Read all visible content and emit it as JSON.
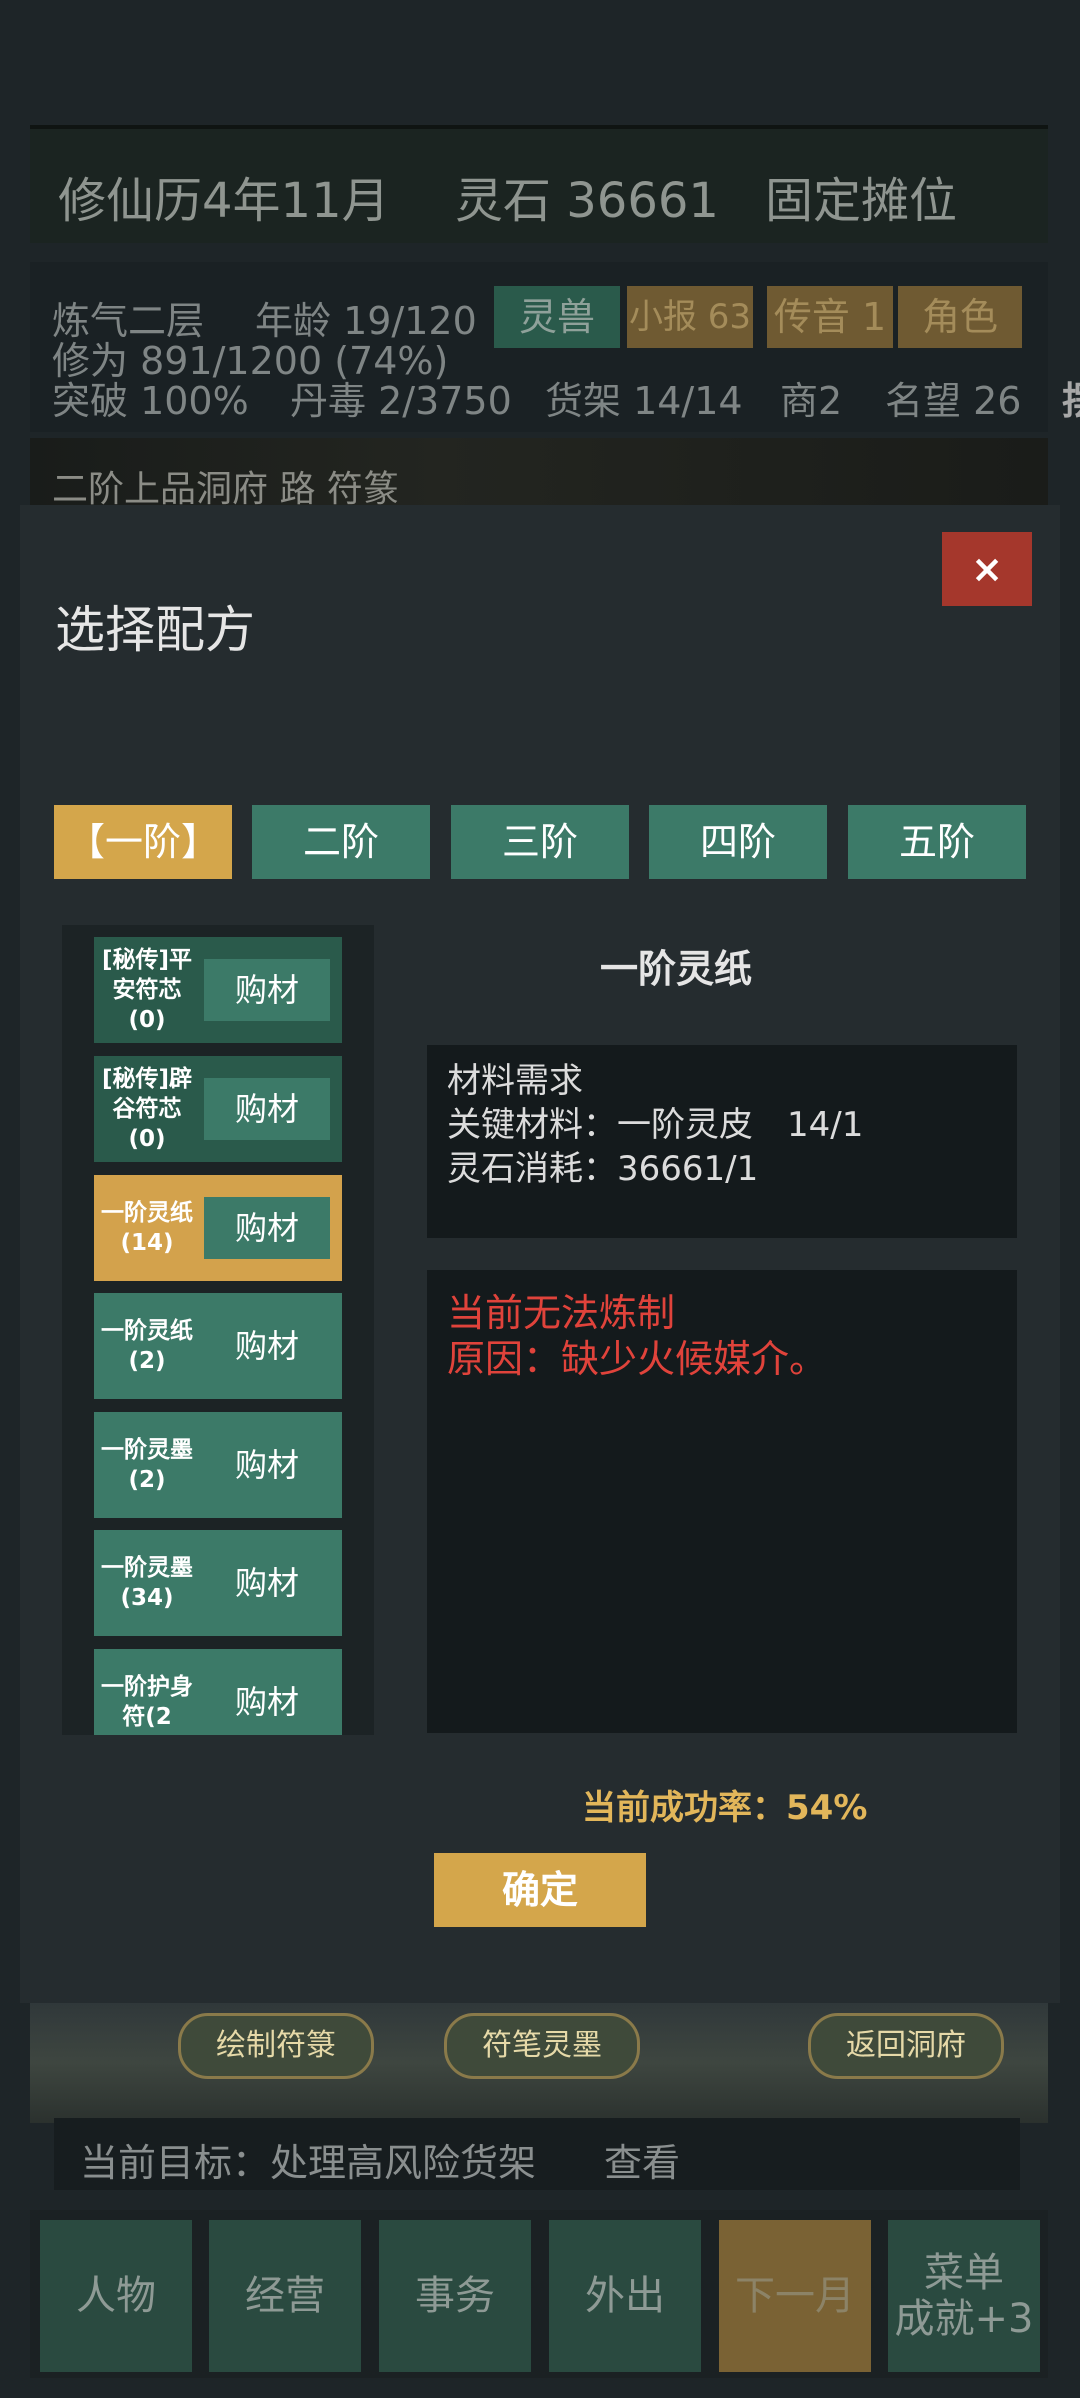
{
  "header": {
    "date": "修仙历4年11月",
    "spirit_stone": "灵石 36661",
    "stall": "固定摊位"
  },
  "stats": {
    "realm": "炼气二层",
    "age": "年龄 19/120",
    "cultivation": "修为 891/1200 (74%)",
    "breakthrough": "突破 100%",
    "poison": "丹毒 2/3750",
    "shelf": "货架 14/14",
    "merchant": "商2",
    "fame": "名望 26",
    "edge_char": "摆"
  },
  "top_buttons": {
    "beast": "灵兽",
    "news": "小报 63",
    "message": "传音 1",
    "role": "角色"
  },
  "scene_text": "二阶上品洞府 路 符篆",
  "dialog": {
    "title": "选择配方",
    "close_label": "×",
    "tiers": [
      "【一阶】",
      "二阶",
      "三阶",
      "四阶",
      "五阶"
    ],
    "items": [
      {
        "name": "[秘传]平安符芯(0)",
        "buy": "购材"
      },
      {
        "name": "[秘传]辟谷符芯(0)",
        "buy": "购材"
      },
      {
        "name": "一阶灵纸(14)",
        "buy": "购材"
      },
      {
        "name": "一阶灵纸(2)",
        "buy": "购材"
      },
      {
        "name": "一阶灵墨(2)",
        "buy": "购材"
      },
      {
        "name": "一阶灵墨(34)",
        "buy": "购材"
      },
      {
        "name": "一阶护身符(2",
        "buy": "购材"
      }
    ],
    "recipe_title": "一阶灵纸",
    "materials": {
      "heading": "材料需求",
      "key_material": "关键材料：一阶灵皮　14/1",
      "stone_cost": "灵石消耗：36661/1"
    },
    "error": {
      "line1": "当前无法炼制",
      "line2": "原因：缺少火候媒介。"
    },
    "success_rate": "当前成功率：54%",
    "confirm_label": "确定"
  },
  "scene_buttons": {
    "draw": "绘制符箓",
    "brush": "符笔灵墨",
    "return": "返回洞府"
  },
  "goal": {
    "text": "当前目标：处理高风险货架",
    "view": "查看"
  },
  "nav": {
    "character": "人物",
    "manage": "经营",
    "affairs": "事务",
    "outing": "外出",
    "next_month": "下一月",
    "menu_line1": "菜单",
    "menu_line2": "成就+3"
  },
  "colors": {
    "accent_gold": "#d4a64b",
    "teal": "#3c7a68",
    "close_red": "#a5372c",
    "error_red": "#e0433b"
  }
}
